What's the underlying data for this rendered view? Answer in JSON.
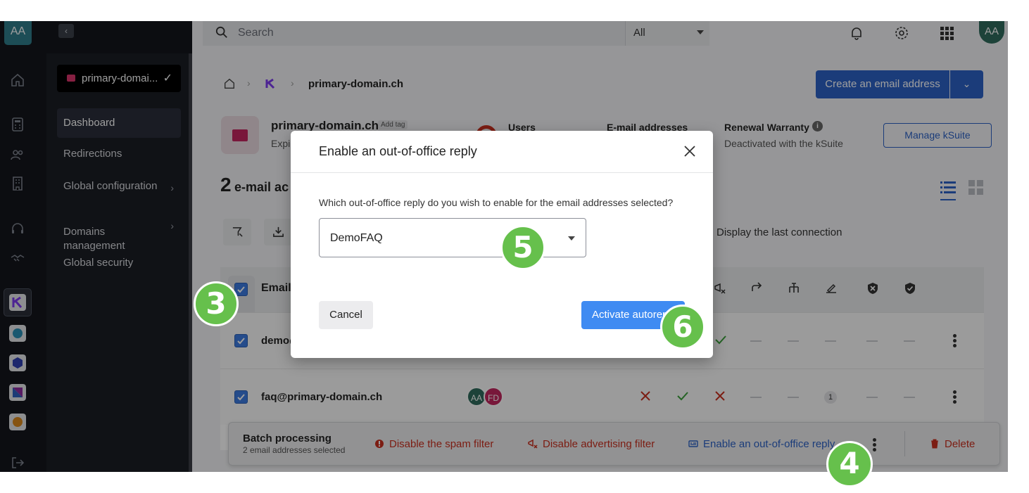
{
  "rail": {
    "avatar": "AA",
    "icons": [
      "home-icon",
      "calculator-icon",
      "users-icon",
      "building-icon",
      "headset-icon",
      "handshake-icon"
    ],
    "apps": [
      "kmail-app",
      "kdrive-app",
      "cube-app",
      "kchat-app",
      "swiss-app"
    ]
  },
  "sidebar": {
    "domain_select": "primary-domai...",
    "items": [
      {
        "label": "Dashboard",
        "active": true
      },
      {
        "label": "Redirections"
      },
      {
        "label": "Global configuration",
        "has_arrow": true
      },
      {
        "label": "Domains\nmanagement",
        "has_arrow": true
      },
      {
        "label": "Global security"
      }
    ]
  },
  "topbar": {
    "search_placeholder": "Search",
    "scope": "All",
    "avatar": "AA"
  },
  "breadcrumb": {
    "domain": "primary-domain.ch"
  },
  "actions": {
    "create_label": "Create an email address",
    "manage_label": "Manage kSuite"
  },
  "domain_card": {
    "name": "primary-domain.ch",
    "tag": "Add tag",
    "sub": "Expi",
    "stat_users": "Users",
    "stat_emails": "E-mail addresses",
    "renewal_label": "Renewal Warranty",
    "renewal_sub": "Deactivated with the kSuite"
  },
  "list": {
    "count": "2",
    "count_label": "e-mail ac",
    "display_last": "Display the last connection",
    "header_email": "Email",
    "rows": [
      {
        "email": "demo@",
        "checked": true
      },
      {
        "email": "faq@primary-domain.ch",
        "checked": true,
        "avatars": [
          "AA",
          "FD"
        ],
        "badge": "1"
      }
    ]
  },
  "batch": {
    "title": "Batch processing",
    "subtitle": "2 email addresses selected",
    "actions": [
      {
        "label": "Disable the spam filter",
        "color": "#c9301f"
      },
      {
        "label": "Disable advertising filter",
        "color": "#c9301f"
      },
      {
        "label": "Enable an out-of-office reply",
        "color": "#2d62c5"
      }
    ],
    "delete_label": "Delete"
  },
  "modal": {
    "title": "Enable an out-of-office reply",
    "question": "Which out-of-office reply do you wish to enable for the email addresses selected?",
    "selected_reply": "DemoFAQ",
    "cancel_label": "Cancel",
    "activate_label": "Activate autoreply"
  },
  "steps": {
    "s3": "3",
    "s4": "4",
    "s5": "5",
    "s6": "6"
  },
  "colors": {
    "accent": "#2d62c5",
    "danger": "#c9301f",
    "success": "#3aa13a",
    "step": "#66c04c"
  }
}
